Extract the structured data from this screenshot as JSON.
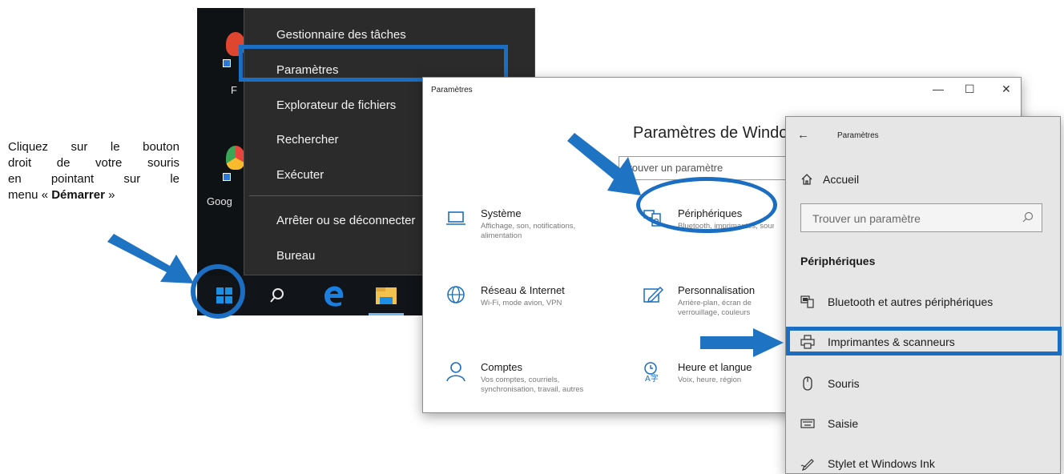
{
  "instruction": {
    "line1": "Cliquez sur le bouton",
    "line2": "droit de votre souris",
    "line3": "en pointant sur le",
    "line4_prefix": "menu « ",
    "line4_bold": "Démarrer",
    "line4_suffix": " »"
  },
  "desktop": {
    "icon1_label": "F",
    "icon2_label": "Goog"
  },
  "context_menu": {
    "items": [
      "Gestionnaire des tâches",
      "Paramètres",
      "Explorateur de fichiers",
      "Rechercher",
      "Exécuter",
      "Arrêter ou se déconnecter",
      "Bureau"
    ]
  },
  "settings_window": {
    "title": "Paramètres",
    "minimize": "—",
    "maximize": "☐",
    "close": "✕",
    "heading": "Paramètres de Windows",
    "search_placeholder": "Trouver un paramètre",
    "categories": [
      {
        "title": "Système",
        "desc": "Affichage, son, notifications, alimentation",
        "icon": "laptop-icon"
      },
      {
        "title": "Périphériques",
        "desc": "Bluetooth, imprimantes, souris",
        "icon": "devices-icon"
      },
      {
        "title": "Réseau & Internet",
        "desc": "Wi-Fi, mode avion, VPN",
        "icon": "globe-icon"
      },
      {
        "title": "Personnalisation",
        "desc": "Arrière-plan, écran de verrouillage, couleurs",
        "icon": "pen-icon"
      },
      {
        "title": "Comptes",
        "desc": "Vos comptes, courriels, synchronisation, travail, autres",
        "icon": "person-icon"
      },
      {
        "title": "Heure et langue",
        "desc": "Voix, heure, région",
        "icon": "time-language-icon"
      }
    ]
  },
  "devices_panel": {
    "back": "←",
    "title": "Paramètres",
    "home": "Accueil",
    "search_placeholder": "Trouver un paramètre",
    "section": "Périphériques",
    "items": [
      {
        "label": "Bluetooth et autres périphériques",
        "icon": "bluetooth-device-icon"
      },
      {
        "label": "Imprimantes & scanneurs",
        "icon": "printer-icon"
      },
      {
        "label": "Souris",
        "icon": "mouse-icon"
      },
      {
        "label": "Saisie",
        "icon": "keyboard-icon"
      },
      {
        "label": "Stylet et Windows Ink",
        "icon": "pen-ink-icon"
      }
    ]
  },
  "colors": {
    "highlight": "#1b6ec2",
    "arrow": "#1f73c3",
    "menu_bg": "#2b2b2b",
    "desktop_bg": "#0f1215",
    "panel_bg": "#e6e6e6"
  }
}
